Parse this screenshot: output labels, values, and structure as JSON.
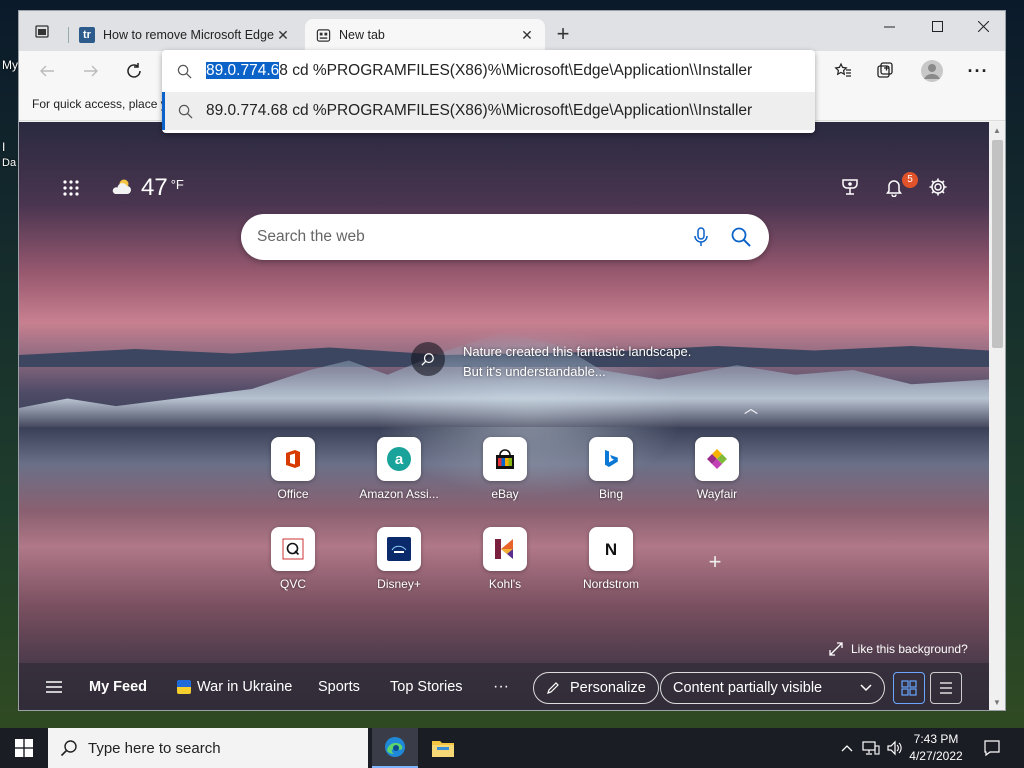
{
  "desktop": {
    "label1": "My",
    "label2": "I",
    "label3": "Da"
  },
  "tabs": [
    {
      "title": "How to remove Microsoft Edge",
      "favicon": "tr"
    },
    {
      "title": "New tab",
      "favicon": "newtab-icon"
    }
  ],
  "favorites_bar": {
    "text": "For quick access, place y"
  },
  "omnibox": {
    "selected_text": "89.0.774.6",
    "rest_text": "8 cd %PROGRAMFILES(X86)%\\Microsoft\\Edge\\Application\\\\Installer",
    "suggestion": "89.0.774.68 cd %PROGRAMFILES(X86)%\\Microsoft\\Edge\\Application\\\\Installer"
  },
  "weather": {
    "temp": "47",
    "unit": "°F"
  },
  "notifications": {
    "count": "5"
  },
  "search": {
    "placeholder": "Search the web"
  },
  "image_caption": {
    "line1": "Nature created this fantastic landscape.",
    "line2": "But it's understandable..."
  },
  "quick_links": [
    {
      "label": "Office"
    },
    {
      "label": "Amazon Assi..."
    },
    {
      "label": "eBay"
    },
    {
      "label": "Bing"
    },
    {
      "label": "Wayfair"
    },
    {
      "label": "QVC"
    },
    {
      "label": "Disney+"
    },
    {
      "label": "Kohl's"
    },
    {
      "label": "Nordstrom"
    }
  ],
  "like_background": "Like this background?",
  "feed": {
    "my_feed": "My Feed",
    "ukraine": "War in Ukraine",
    "sports": "Sports",
    "top_stories": "Top Stories",
    "more": "···",
    "personalize": "Personalize",
    "content_visibility": "Content partially visible"
  },
  "taskbar": {
    "search_placeholder": "Type here to search",
    "time": "7:43 PM",
    "date": "4/27/2022"
  },
  "colors": {
    "accent": "#0b62c9",
    "badge": "#e0532a"
  }
}
